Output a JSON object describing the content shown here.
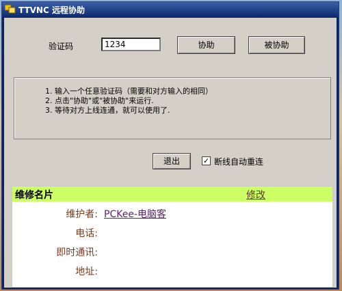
{
  "window": {
    "title": "TTVNC 远程协助"
  },
  "form": {
    "code_label": "验证码",
    "code_value": "1234",
    "assist_button": "协助",
    "be_assisted_button": "被协助"
  },
  "instructions": [
    "1. 输入一个任意验证码（需要和对方输入的相同）",
    "2. 点击\"协助\"或\"被协助\"来运行.",
    "3. 等待对方上线连通，就可以使用了."
  ],
  "controls": {
    "exit_button": "退出",
    "auto_reconnect_label": "断线自动重连",
    "auto_reconnect_checked": true
  },
  "card": {
    "title": "维修名片",
    "edit_link": "修改",
    "maintainer_label": "维护者:",
    "maintainer_value": "PCKee-电脑客",
    "phone_label": "电话:",
    "im_label": "即时通讯:",
    "address_label": "地址:"
  }
}
